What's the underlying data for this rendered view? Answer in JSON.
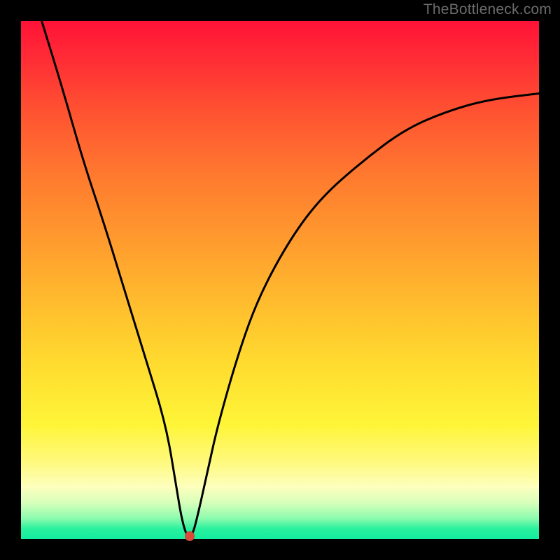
{
  "watermark": "TheBottleneck.com",
  "chart_data": {
    "type": "line",
    "title": "",
    "xlabel": "",
    "ylabel": "",
    "xlim": [
      0,
      100
    ],
    "ylim": [
      0,
      100
    ],
    "grid": false,
    "legend": false,
    "series": [
      {
        "name": "bottleneck-curve",
        "x": [
          4,
          8,
          12,
          16,
          20,
          24,
          28,
          30,
          31,
          32,
          33,
          34,
          36,
          38,
          42,
          46,
          52,
          58,
          66,
          74,
          82,
          90,
          100
        ],
        "values": [
          100,
          87,
          73,
          61,
          48,
          35,
          22,
          10,
          4,
          0.5,
          0.5,
          4,
          13,
          22,
          36,
          47,
          58,
          66,
          73,
          79,
          82.5,
          84.8,
          86
        ]
      }
    ],
    "marker": {
      "x": 32.5,
      "y": 0.5,
      "color": "#d94a3b"
    },
    "background_gradient_stops": [
      {
        "pos": 0,
        "color": "#ff1237"
      },
      {
        "pos": 50,
        "color": "#ffb82e"
      },
      {
        "pos": 80,
        "color": "#fff64a"
      },
      {
        "pos": 100,
        "color": "#14eea0"
      }
    ]
  }
}
